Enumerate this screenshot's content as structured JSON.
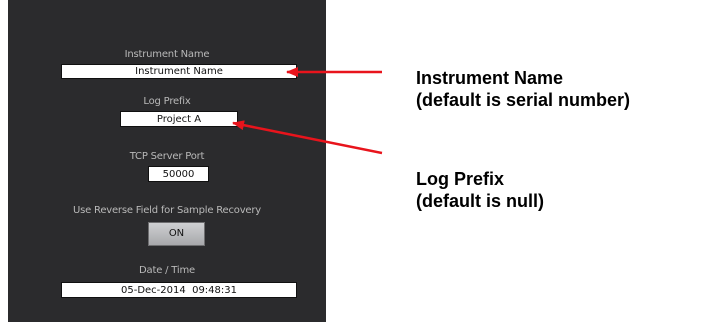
{
  "settings": {
    "instrument_name": {
      "label": "Instrument Name",
      "value": "Instrument Name"
    },
    "log_prefix": {
      "label": "Log Prefix",
      "value": "Project A"
    },
    "tcp_port": {
      "label": "TCP Server Port",
      "value": "50000"
    },
    "reverse_field": {
      "label": "Use Reverse Field for Sample Recovery",
      "button": "ON"
    },
    "date_time": {
      "label": "Date / Time",
      "value": "05-Dec-2014  09:48:31"
    }
  },
  "annotations": {
    "instrument_name": {
      "line1": "Instrument Name",
      "line2": "(default is serial number)"
    },
    "log_prefix": {
      "line1": "Log Prefix",
      "line2": "(default is null)"
    }
  },
  "colors": {
    "arrow": "#e8141c",
    "panel": "#2b2b2d"
  }
}
